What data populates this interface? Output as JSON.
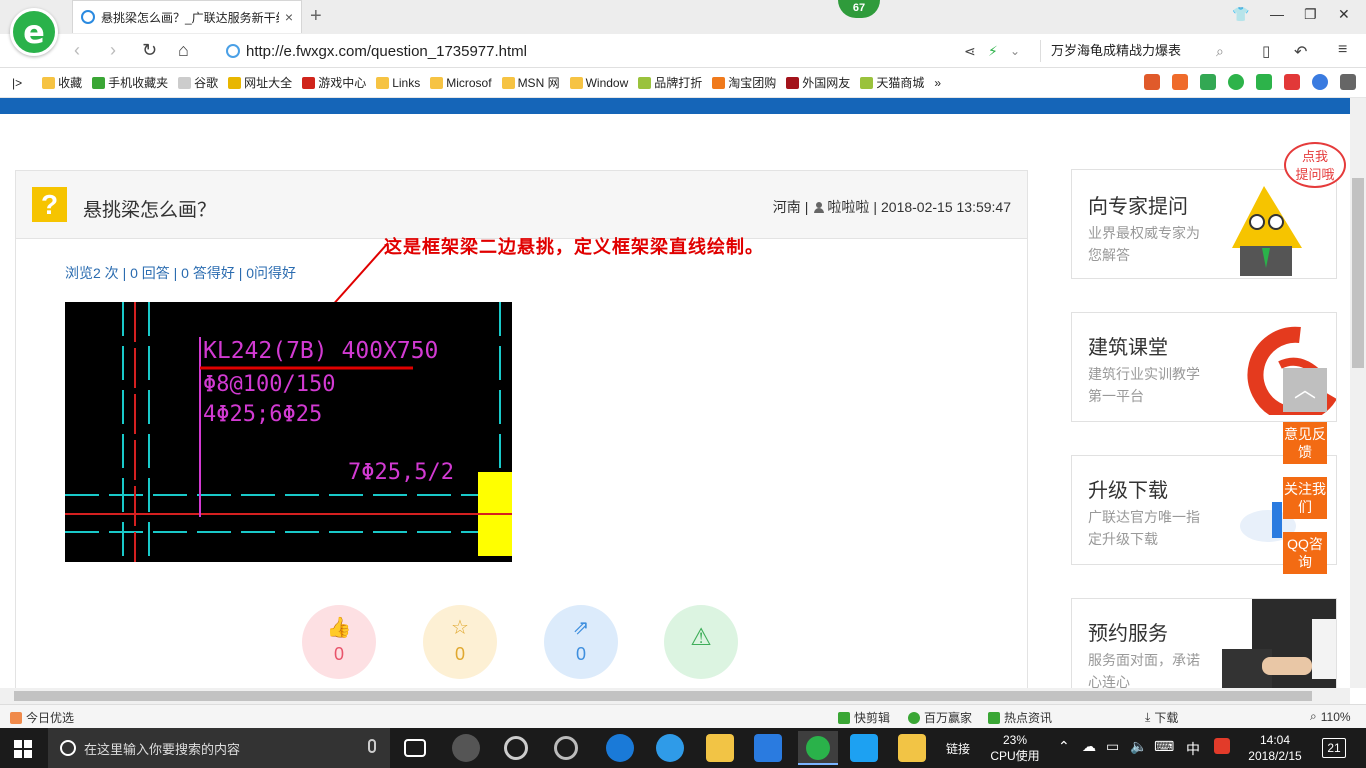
{
  "browser": {
    "logo_letter": "e",
    "tab_title": "悬挑梁怎么画？_广联达服务新干线",
    "tab_close": "×",
    "new_tab": "+",
    "notification_count": "67",
    "url": "http://e.fwxgx.com/question_1735977.html",
    "search_text": "万岁海龟成精战力爆表"
  },
  "bookmarks": [
    {
      "label": "收藏",
      "color": "#f6c343"
    },
    {
      "label": "手机收藏夹",
      "color": "#3aa635"
    },
    {
      "label": "谷歌",
      "color": "#cccccc"
    },
    {
      "label": "网址大全",
      "color": "#e8b600"
    },
    {
      "label": "游戏中心",
      "color": "#d0241b"
    },
    {
      "label": "Links",
      "color": "#f6c343"
    },
    {
      "label": "Microsof",
      "color": "#f6c343"
    },
    {
      "label": "MSN 网",
      "color": "#f6c343"
    },
    {
      "label": "Window",
      "color": "#f6c343"
    },
    {
      "label": "品牌打折",
      "color": "#9ac23c"
    },
    {
      "label": "淘宝团购",
      "color": "#f07a1c"
    },
    {
      "label": "外国网友",
      "color": "#a3131b"
    },
    {
      "label": "天猫商城",
      "color": "#9ac23c"
    },
    {
      "label": "»",
      "color": ""
    }
  ],
  "question": {
    "icon": "?",
    "title": "悬挑梁怎么画？",
    "region": "河南",
    "sep": "|",
    "author": "啦啦啦",
    "date": "2018-02-15 13:59:47",
    "stats": "浏览2 次 | 0 回答 | 0 答得好 | 0问得好",
    "annotation": "这是框架梁二边悬挑，定义框架梁直线绘制。"
  },
  "cad": {
    "beam_label": "KL242(7B) 400X750",
    "stirrup": "Φ8@100/150",
    "top_bars": "4Φ25;6Φ25",
    "bottom_bars": "7Φ25,5/2"
  },
  "actions": [
    {
      "name": "like",
      "icon": "👍",
      "count": "0",
      "bg": "#fde0e3",
      "fg": "#e8546b"
    },
    {
      "name": "favorite",
      "icon": "☆",
      "count": "0",
      "bg": "#fdf0d4",
      "fg": "#e0a830"
    },
    {
      "name": "share",
      "icon": "⇗",
      "count": "0",
      "bg": "#dcebfb",
      "fg": "#3f8fde"
    },
    {
      "name": "report",
      "icon": "⚠",
      "count": "",
      "bg": "#dcf4e1",
      "fg": "#3fae5a"
    }
  ],
  "sidebar": {
    "bubble": "点我\n提问哦",
    "cards": [
      {
        "title": "向专家提问",
        "sub": "业界最权威专家为您解答"
      },
      {
        "title": "建筑课堂",
        "sub": "建筑行业实训教学第一平台"
      },
      {
        "title": "升级下载",
        "sub": "广联达官方唯一指定升级下载"
      },
      {
        "title": "预约服务",
        "sub": "服务面对面，承诺心连心"
      }
    ],
    "float": {
      "top": "︿",
      "feedback": "意见反馈",
      "follow": "关注我们",
      "qq": "QQ咨询"
    }
  },
  "statusbar": {
    "left": "今日优选",
    "items": [
      "快剪辑",
      "百万赢家",
      "热点资讯",
      "下载",
      "110%"
    ]
  },
  "taskbar": {
    "search_placeholder": "在这里输入你要搜索的内容",
    "link": "链接",
    "cpu_percent": "23%",
    "cpu_label": "CPU使用",
    "ime": "中",
    "time": "14:04",
    "date": "2018/2/15",
    "notification_badge": "21"
  }
}
